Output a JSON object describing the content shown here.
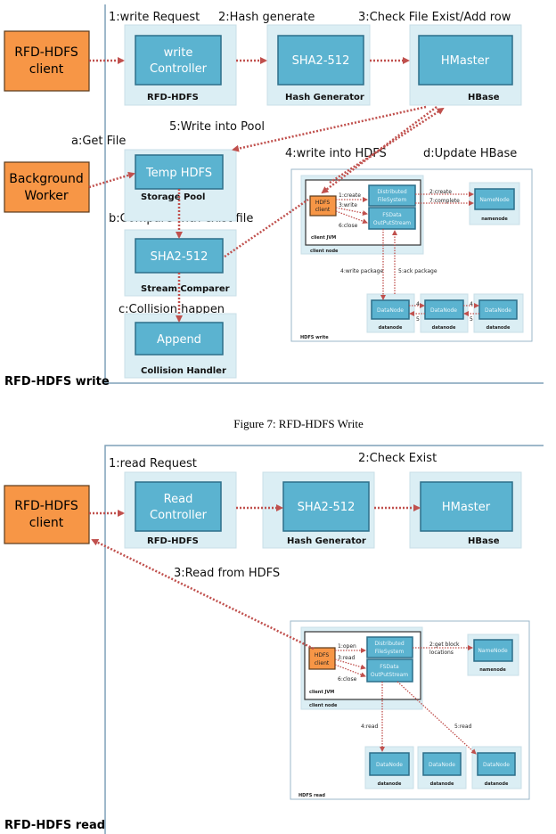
{
  "write_diagram": {
    "title": "RFD-HDFS write",
    "steps": {
      "s1": "1:write Request",
      "s2": "2:Hash generate",
      "s3": "3:Check File Exist/Add row",
      "s4": "4:write into HDFS",
      "s5": "5:Write into Pool",
      "sa": "a:Get File",
      "sb": "b:Compare with exist file",
      "sc": "c:Collision happen",
      "sd": "d:Update HBase"
    },
    "client": [
      "RFD-HDFS",
      "client"
    ],
    "worker": [
      "Background",
      "Worker"
    ],
    "controller": {
      "inner": [
        "write",
        "Controller"
      ],
      "label": "RFD-HDFS"
    },
    "hash": {
      "inner": "SHA2-512",
      "label": "Hash Generator"
    },
    "hbase": {
      "inner": "HMaster",
      "label": "HBase"
    },
    "pool": {
      "inner": "Temp HDFS",
      "label": "Storage Pool"
    },
    "comparer": {
      "inner": "SHA2-512",
      "label": "Stream Comparer"
    },
    "collision": {
      "inner": "Append",
      "label": "Collision Handler"
    },
    "hdfs": {
      "title": "HDFS write",
      "client": [
        "HDFS",
        "client"
      ],
      "dfs": [
        "Distributed",
        "FileSystem"
      ],
      "fsdata": [
        "FSData",
        "OutPutStream"
      ],
      "jvm": "client JVM",
      "client_node": "client node",
      "namenode": "NameNode",
      "namenode_label": "namenode",
      "datanode": "DataNode",
      "datanode_label": "datanode",
      "e1": "1:create",
      "e3": "3:write",
      "e6": "6:close",
      "e2": "2:create",
      "e7": "7:complete",
      "e4": "4:write package",
      "e5": "5:ack package",
      "n4": "4",
      "n5": "5"
    }
  },
  "caption": "Figure 7: RFD-HDFS Write",
  "read_diagram": {
    "title": "RFD-HDFS read",
    "steps": {
      "s1": "1:read Request",
      "s2": "2:Check Exist",
      "s3": "3:Read from HDFS"
    },
    "client": [
      "RFD-HDFS",
      "client"
    ],
    "controller": {
      "inner": [
        "Read",
        "Controller"
      ],
      "label": "RFD-HDFS"
    },
    "hash": {
      "inner": "SHA2-512",
      "label": "Hash Generator"
    },
    "hbase": {
      "inner": "HMaster",
      "label": "HBase"
    },
    "hdfs": {
      "title": "HDFS read",
      "client": [
        "HDFS",
        "client"
      ],
      "dfs": [
        "Distributed",
        "FileSystem"
      ],
      "fsdata": [
        "FSData",
        "OutPutStream"
      ],
      "jvm": "client JVM",
      "client_node": "client node",
      "namenode": "NameNode",
      "namenode_label": "namenode",
      "datanode": "DataNode",
      "datanode_label": "datanode",
      "e1": "1:open",
      "e3": "3:read",
      "e6": "6:close",
      "e2a": "2:get block",
      "e2b": "locations",
      "e4": "4:read",
      "e5": "5:read"
    }
  },
  "colors": {
    "arrow": "#c0504d",
    "panel": "#dbeef4",
    "component": "#5bb3d0",
    "actor": "#f79646"
  }
}
